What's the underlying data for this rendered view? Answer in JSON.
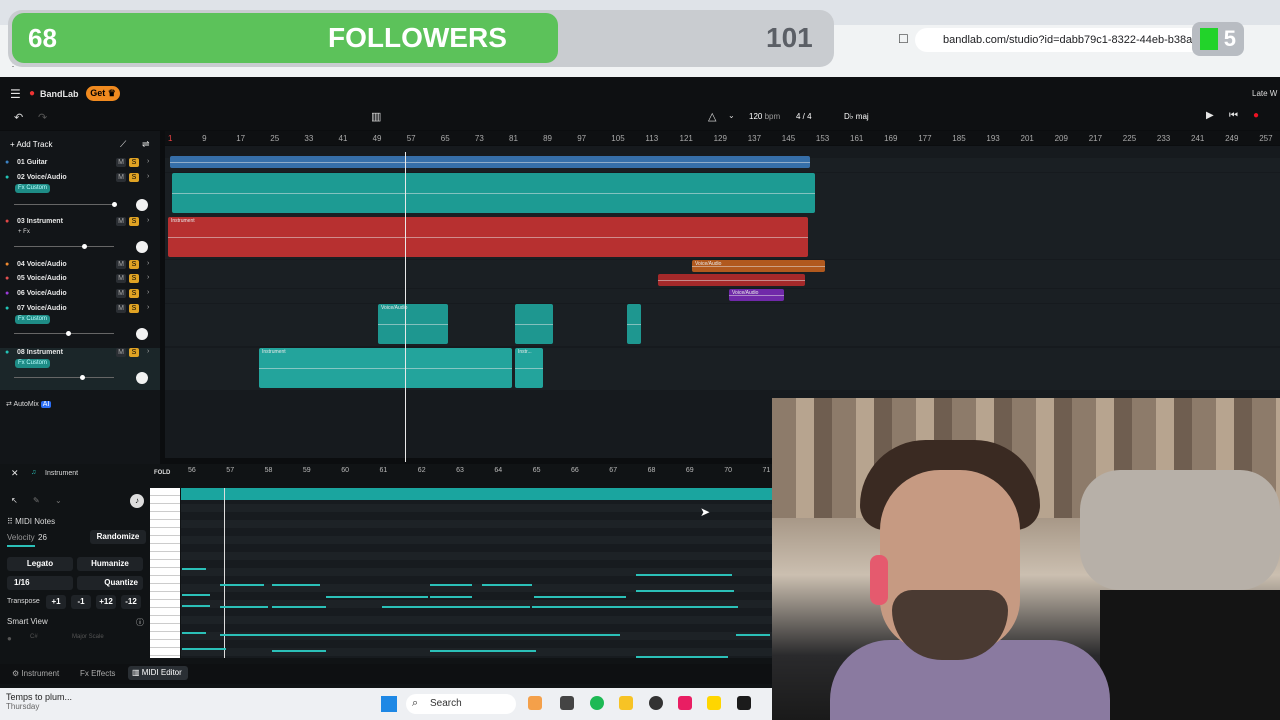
{
  "overlay": {
    "current": "68",
    "label": "FOLLOWERS",
    "goal": "101",
    "badge": "5"
  },
  "browser": {
    "url": "bandlab.com/studio?id=dabb79c1-8322-44eb-b38a-05db86"
  },
  "bandlab": {
    "brand": "BandLab",
    "get_label": "Get",
    "right_text": "Late W"
  },
  "transport": {
    "bpm": "120",
    "bpm_unit": "bpm",
    "time_sig": "4 / 4",
    "key": "D♭ maj"
  },
  "toolbar": {
    "add_track": "Add Track",
    "automix": "AutoMix",
    "ai": "AI"
  },
  "ruler_ticks": [
    "1",
    "9",
    "17",
    "25",
    "33",
    "41",
    "49",
    "57",
    "65",
    "73",
    "81",
    "89",
    "97",
    "105",
    "113",
    "121",
    "129",
    "137",
    "145",
    "153",
    "161",
    "169",
    "177",
    "185",
    "193",
    "201",
    "209",
    "217",
    "225",
    "233",
    "241",
    "249",
    "257"
  ],
  "tracks": [
    {
      "num": "01",
      "name": "Guitar"
    },
    {
      "num": "02",
      "name": "Voice/Audio",
      "fx": "Fx Custom"
    },
    {
      "num": "03",
      "name": "Instrument",
      "fx": "+ Fx"
    },
    {
      "num": "04",
      "name": "Voice/Audio"
    },
    {
      "num": "05",
      "name": "Voice/Audio"
    },
    {
      "num": "06",
      "name": "Voice/Audio"
    },
    {
      "num": "07",
      "name": "Voice/Audio",
      "fx": "Fx Custom"
    },
    {
      "num": "08",
      "name": "Instrument",
      "fx": "Fx Custom"
    }
  ],
  "clips": {
    "instrument": "Instrument",
    "voice": "Voice/Audio",
    "voice_short": "Voic...",
    "instr_short": "Instr..."
  },
  "midi": {
    "title": "Instrument",
    "fold": "FOLD",
    "ruler": [
      "56",
      "57",
      "58",
      "59",
      "60",
      "61",
      "62",
      "63",
      "64",
      "65",
      "66",
      "67",
      "68",
      "69",
      "70",
      "71"
    ],
    "midi_notes": "MIDI Notes",
    "velocity_label": "Velocity",
    "velocity": "26",
    "randomize": "Randomize",
    "legato": "Legato",
    "humanize": "Humanize",
    "grid": "1/16",
    "quantize": "Quantize",
    "transpose": "Transpose",
    "t1": "+1",
    "t2": "-1",
    "t3": "+12",
    "t4": "-12",
    "smart_view": "Smart View",
    "key_sel": "C#",
    "scale_sel": "Major Scale",
    "tab_instrument": "Instrument",
    "tab_effects": "Effects",
    "tab_midi": "MIDI Editor",
    "c_label": "C"
  },
  "taskbar": {
    "weather": "Temps to plum...",
    "day": "Thursday",
    "search": "Search"
  }
}
